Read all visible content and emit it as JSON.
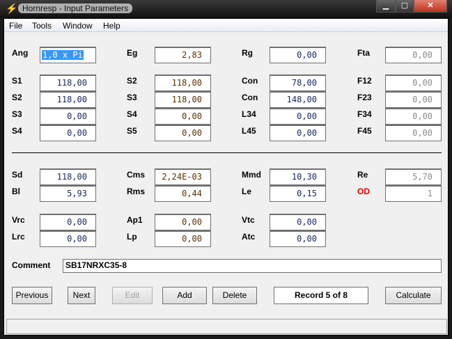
{
  "window": {
    "title": "Hornresp - Input Parameters",
    "controls": [
      "minimize",
      "maximize",
      "close"
    ]
  },
  "menu": [
    "File",
    "Tools",
    "Window",
    "Help"
  ],
  "row0": [
    {
      "label": "Ang",
      "value": "1,0 x Pi"
    },
    {
      "label": "Eg",
      "value": "2,83"
    },
    {
      "label": "Rg",
      "value": "0,00"
    },
    {
      "label": "Fta",
      "value": "0,00"
    }
  ],
  "grid1": [
    [
      {
        "label": "S1",
        "value": "118,00"
      },
      {
        "label": "S2",
        "value": "118,00"
      },
      {
        "label": "Con",
        "value": "78,00"
      },
      {
        "label": "F12",
        "value": "0,00"
      }
    ],
    [
      {
        "label": "S2",
        "value": "118,00"
      },
      {
        "label": "S3",
        "value": "118,00"
      },
      {
        "label": "Con",
        "value": "148,00"
      },
      {
        "label": "F23",
        "value": "0,00"
      }
    ],
    [
      {
        "label": "S3",
        "value": "0,00"
      },
      {
        "label": "S4",
        "value": "0,00"
      },
      {
        "label": "L34",
        "value": "0,00"
      },
      {
        "label": "F34",
        "value": "0,00"
      }
    ],
    [
      {
        "label": "S4",
        "value": "0,00"
      },
      {
        "label": "S5",
        "value": "0,00"
      },
      {
        "label": "L45",
        "value": "0,00"
      },
      {
        "label": "F45",
        "value": "0,00"
      }
    ]
  ],
  "grid2": [
    [
      {
        "label": "Sd",
        "value": "118,00"
      },
      {
        "label": "Cms",
        "value": "2,24E-03"
      },
      {
        "label": "Mmd",
        "value": "10,30"
      },
      {
        "label": "Re",
        "value": "5,70"
      }
    ],
    [
      {
        "label": "Bl",
        "value": "5,93"
      },
      {
        "label": "Rms",
        "value": "0,44"
      },
      {
        "label": "Le",
        "value": "0,15"
      },
      {
        "label": "OD",
        "value": "1"
      }
    ]
  ],
  "grid3": [
    [
      {
        "label": "Vrc",
        "value": "0,00"
      },
      {
        "label": "Ap1",
        "value": "0,00"
      },
      {
        "label": "Vtc",
        "value": "0,00"
      }
    ],
    [
      {
        "label": "Lrc",
        "value": "0,00"
      },
      {
        "label": "Lp",
        "value": "0,00"
      },
      {
        "label": "Atc",
        "value": "0,00"
      }
    ]
  ],
  "comment": {
    "label": "Comment",
    "value": "SB17NRXC35-8"
  },
  "buttons": {
    "previous": "Previous",
    "next": "Next",
    "edit": "Edit",
    "add": "Add",
    "delete": "Delete",
    "calculate": "Calculate"
  },
  "record": "Record 5 of 8",
  "colors": {
    "od_label": "#e00000",
    "selection": "#3399ff"
  }
}
